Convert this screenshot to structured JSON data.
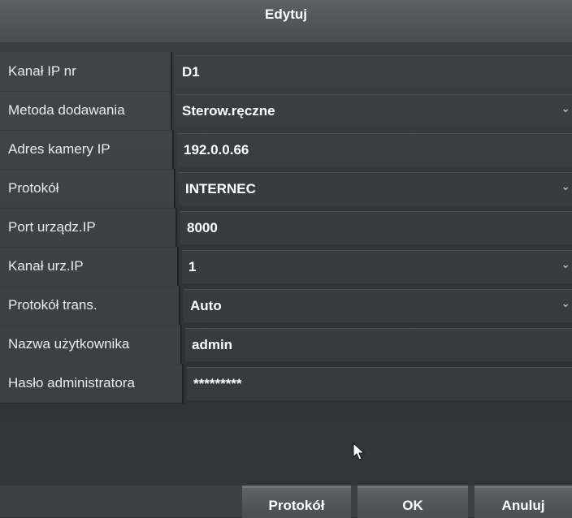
{
  "dialog": {
    "title": "Edytuj"
  },
  "fields": [
    {
      "label": "Kanał IP nr",
      "value": "D1",
      "dropdown": false
    },
    {
      "label": "Metoda dodawania",
      "value": "Sterow.ręczne",
      "dropdown": true
    },
    {
      "label": "Adres kamery IP",
      "value": "192.0.0.66",
      "dropdown": false
    },
    {
      "label": "Protokół",
      "value": "INTERNEC",
      "dropdown": true
    },
    {
      "label": "Port urządz.IP",
      "value": "8000",
      "dropdown": false
    },
    {
      "label": "Kanał urz.IP",
      "value": "1",
      "dropdown": true
    },
    {
      "label": "Protokół trans.",
      "value": "Auto",
      "dropdown": true
    },
    {
      "label": "Nazwa użytkownika",
      "value": "admin",
      "dropdown": false
    },
    {
      "label": "Hasło administratora",
      "value": "*********",
      "dropdown": false
    }
  ],
  "buttons": {
    "protocol": "Protokół",
    "ok": "OK",
    "cancel": "Anuluj"
  },
  "icons": {
    "dropdown": "chevron-down-icon",
    "cursor": "mouse-pointer-icon"
  },
  "colors": {
    "background": "#30363a",
    "title_bar": "#4f5558",
    "text": "#ffffff"
  }
}
